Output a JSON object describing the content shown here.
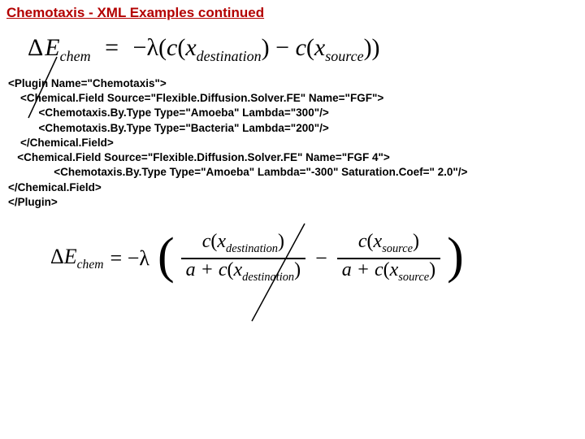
{
  "title": "Chemotaxis - XML Examples continued",
  "eq1": {
    "lhs_delta": "Δ",
    "lhs_E": "E",
    "lhs_sub": "chem",
    "eq": "=",
    "rhs_prefix": "−λ(",
    "c1": "c",
    "x1": "x",
    "sub1": "destination",
    "mid": ") − ",
    "c2": "c",
    "x2": "x",
    "sub2": "source",
    "rhs_suffix": "))"
  },
  "xml": {
    "l1": "<Plugin Name=\"Chemotaxis\">",
    "l2": "    <Chemical.Field Source=\"Flexible.Diffusion.Solver.FE\" Name=\"FGF\">",
    "l3": "          <Chemotaxis.By.Type Type=\"Amoeba\" Lambda=\"300\"/>",
    "l4": "          <Chemotaxis.By.Type Type=\"Bacteria\" Lambda=\"200\"/>",
    "l5": "    </Chemical.Field>",
    "l6": "   <Chemical.Field Source=\"Flexible.Diffusion.Solver.FE\" Name=\"FGF 4\">",
    "l7": "               <Chemotaxis.By.Type Type=\"Amoeba\" Lambda=\"-300\" Saturation.Coef=\" 2.0\"/>",
    "l8": "</Chemical.Field>",
    "l9": "</Plugin>"
  },
  "eq2": {
    "lhs_delta": "Δ",
    "lhs_E": "E",
    "lhs_sub": "chem",
    "eq": "= −λ",
    "num1_c": "c",
    "num1_x": "x",
    "num1_sub": "destination",
    "den1_a": "a + ",
    "den1_c": "c",
    "den1_x": "x",
    "den1_sub": "destination",
    "minus": "−",
    "num2_c": "c",
    "num2_x": "x",
    "num2_sub": "source",
    "den2_a": "a + ",
    "den2_c": "c",
    "den2_x": "x",
    "den2_sub": "source"
  }
}
